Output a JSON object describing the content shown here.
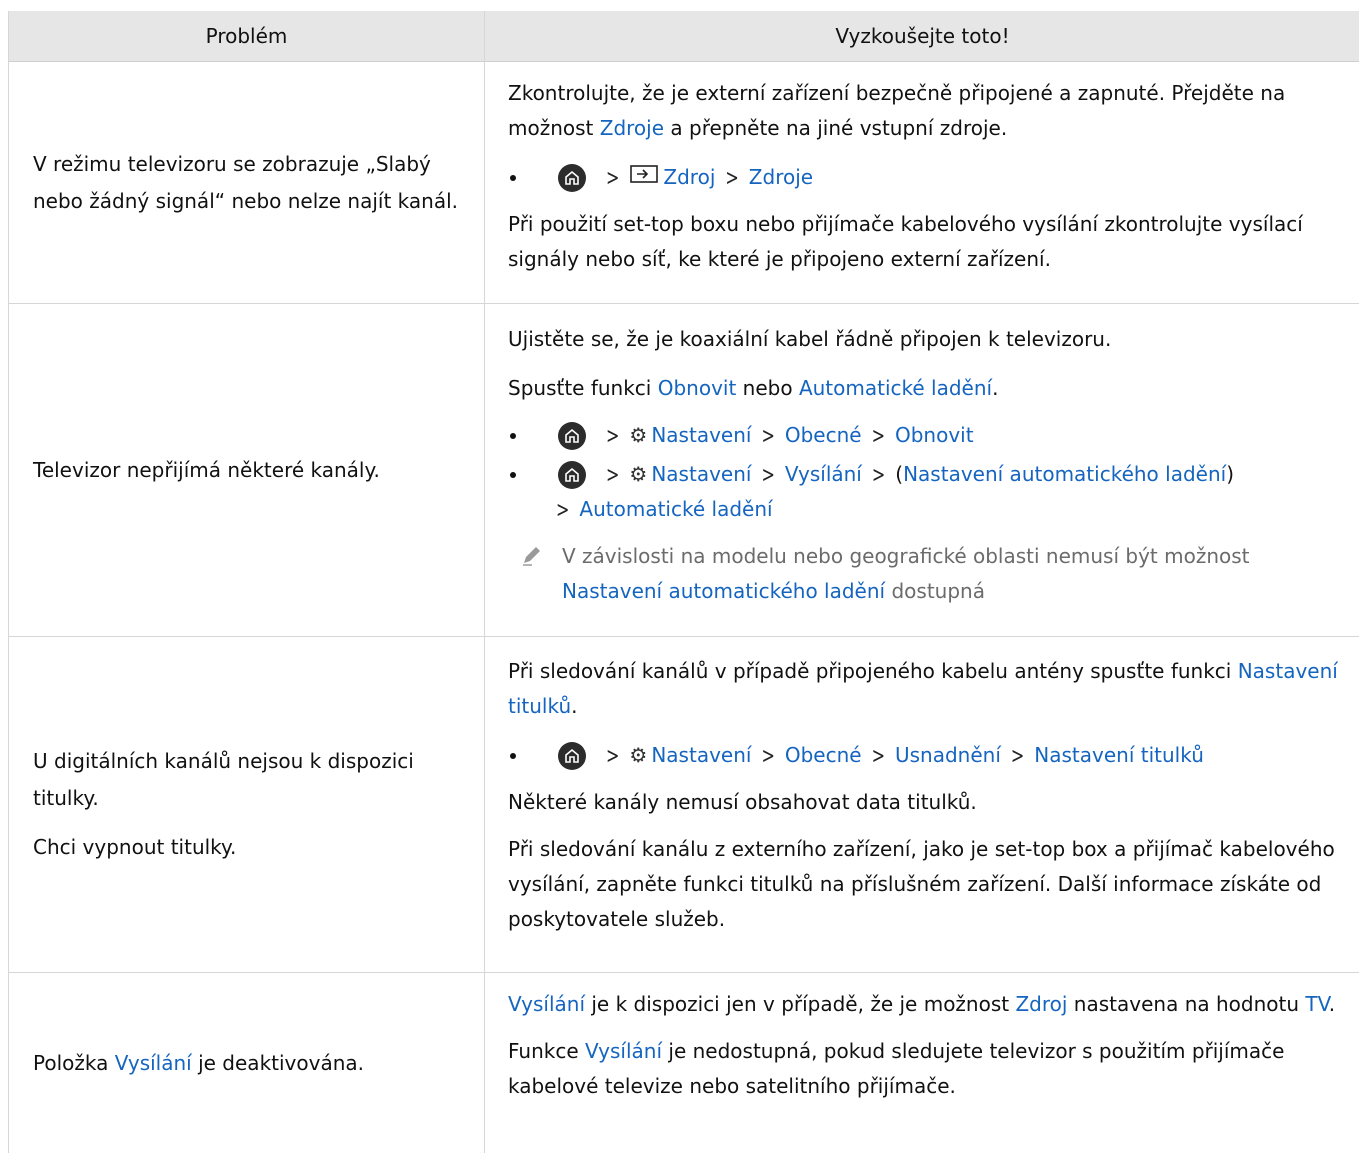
{
  "header": {
    "col1": "Problém",
    "col2": "Vyzkoušejte toto!"
  },
  "rows": [
    {
      "problem": "V režimu televizoru se zobrazuje „Slabý nebo žádný signál“ nebo nelze najít kanál.",
      "s1_a": "Zkontrolujte, že je externí zařízení bezpečně připojené a zapnuté. Přejděte na možnost ",
      "s1_link": "Zdroje",
      "s1_b": " a přepněte na jiné vstupní zdroje.",
      "path": [
        "Zdroj",
        "Zdroje"
      ],
      "s2": "Při použití set-top boxu nebo přijímače kabelového vysílání zkontrolujte vysílací signály nebo síť, ke které je připojeno externí zařízení."
    },
    {
      "problem": "Televizor nepřijímá některé kanály.",
      "s1": "Ujistěte se, že je koaxiální kabel řádně připojen k televizoru.",
      "s2_a": "Spusťte funkci ",
      "s2_link1": "Obnovit",
      "s2_mid": " nebo ",
      "s2_link2": "Automatické ladění",
      "s2_end": ".",
      "path1": [
        "Nastavení",
        "Obecné",
        "Obnovit"
      ],
      "path2": [
        "Nastavení",
        "Vysílání",
        "Nastavení automatického ladění",
        "Automatické ladění"
      ],
      "note_a": "V závislosti na modelu nebo geografické oblasti nemusí být možnost ",
      "note_link": "Nastavení automatického ladění",
      "note_b": " dostupná"
    },
    {
      "problem1": "U digitálních kanálů nejsou k dispozici titulky.",
      "problem2": "Chci vypnout titulky.",
      "s1_a": "Při sledování kanálů v případě připojeného kabelu antény spusťte funkci ",
      "s1_link": "Nastavení titulků",
      "s1_end": ".",
      "path": [
        "Nastavení",
        "Obecné",
        "Usnadnění",
        "Nastavení titulků"
      ],
      "s2": "Některé kanály nemusí obsahovat data titulků.",
      "s3": "Při sledování kanálu z externího zařízení, jako je set-top box a přijímač kabelového vysílání, zapněte funkci titulků na příslušném zařízení. Další informace získáte od poskytovatele služeb."
    },
    {
      "problem_a": "Položka ",
      "problem_link": "Vysílání",
      "problem_b": " je deaktivována.",
      "s1_link1": "Vysílání",
      "s1_a": " je k dispozici jen v případě, že je možnost ",
      "s1_link2": "Zdroj",
      "s1_b": " nastavena na hodnotu ",
      "s1_link3": "TV",
      "s1_end": ".",
      "s2_a": "Funkce ",
      "s2_link": "Vysílání",
      "s2_b": " je nedostupná, pokud sledujete televizor s použitím přijímače kabelové televize nebo satelitního přijímače."
    }
  ],
  "icons": [
    "home-icon",
    "chevron-right-icon",
    "source-icon",
    "gear-icon",
    "pencil-note-icon"
  ]
}
